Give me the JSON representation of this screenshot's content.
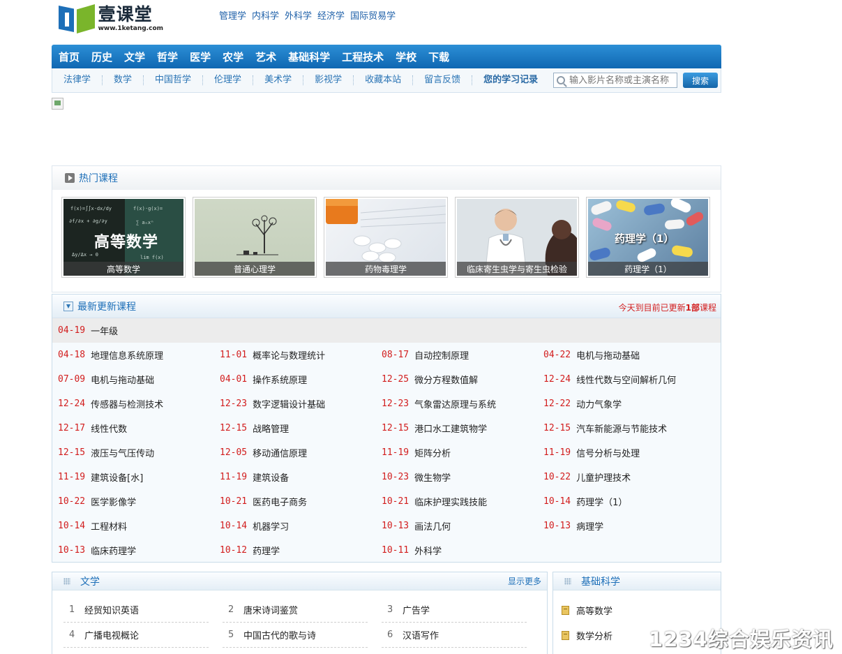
{
  "logo": {
    "name_cn": "壹课堂",
    "url": "www.1ketang.com"
  },
  "top_links": [
    "管理学",
    "内科学",
    "外科学",
    "经济学",
    "国际贸易学"
  ],
  "main_nav": [
    "首页",
    "历史",
    "文学",
    "哲学",
    "医学",
    "农学",
    "艺术",
    "基础科学",
    "工程技术",
    "学校",
    "下载"
  ],
  "sub_nav": [
    "法律学",
    "数学",
    "中国哲学",
    "伦理学",
    "美术学",
    "影视学",
    "收藏本站",
    "留言反馈"
  ],
  "sub_nav_strong": "您的学习记录",
  "search": {
    "placeholder": "输入影片名称或主演名称",
    "button": "搜索"
  },
  "hot": {
    "title": "热门课程",
    "courses": [
      {
        "caption": "高等数学",
        "overlay": "高等数学"
      },
      {
        "caption": "普通心理学"
      },
      {
        "caption": "药物毒理学"
      },
      {
        "caption": "临床寄生虫学与寄生虫检验"
      },
      {
        "caption": "药理学（1）",
        "overlay": "药理学（1）"
      }
    ]
  },
  "latest": {
    "title": "最新更新课程",
    "note_prefix": "今天到目前已更新",
    "note_count": "1部",
    "note_suffix": "课程",
    "first": {
      "date": "04-19",
      "name": "一年级"
    },
    "rows": [
      [
        {
          "date": "04-18",
          "name": "地理信息系统原理"
        },
        {
          "date": "11-01",
          "name": "概率论与数理统计"
        },
        {
          "date": "08-17",
          "name": "自动控制原理"
        },
        {
          "date": "04-22",
          "name": "电机与拖动基础"
        }
      ],
      [
        {
          "date": "07-09",
          "name": "电机与拖动基础"
        },
        {
          "date": "04-01",
          "name": "操作系统原理"
        },
        {
          "date": "12-25",
          "name": "微分方程数值解"
        },
        {
          "date": "12-24",
          "name": "线性代数与空间解析几何"
        }
      ],
      [
        {
          "date": "12-24",
          "name": "传感器与检测技术"
        },
        {
          "date": "12-23",
          "name": "数字逻辑设计基础"
        },
        {
          "date": "12-23",
          "name": "气象雷达原理与系统"
        },
        {
          "date": "12-22",
          "name": "动力气象学"
        }
      ],
      [
        {
          "date": "12-17",
          "name": "线性代数"
        },
        {
          "date": "12-15",
          "name": "战略管理"
        },
        {
          "date": "12-15",
          "name": "港口水工建筑物学"
        },
        {
          "date": "12-15",
          "name": "汽车新能源与节能技术"
        }
      ],
      [
        {
          "date": "12-15",
          "name": "液压与气压传动"
        },
        {
          "date": "12-05",
          "name": "移动通信原理"
        },
        {
          "date": "11-19",
          "name": "矩阵分析"
        },
        {
          "date": "11-19",
          "name": "信号分析与处理"
        }
      ],
      [
        {
          "date": "11-19",
          "name": "建筑设备[水]"
        },
        {
          "date": "11-19",
          "name": "建筑设备"
        },
        {
          "date": "10-23",
          "name": "微生物学"
        },
        {
          "date": "10-22",
          "name": "儿童护理技术"
        }
      ],
      [
        {
          "date": "10-22",
          "name": "医学影像学"
        },
        {
          "date": "10-21",
          "name": "医药电子商务"
        },
        {
          "date": "10-21",
          "name": "临床护理实践技能"
        },
        {
          "date": "10-14",
          "name": "药理学（1）"
        }
      ],
      [
        {
          "date": "10-14",
          "name": "工程材料"
        },
        {
          "date": "10-14",
          "name": "机器学习"
        },
        {
          "date": "10-13",
          "name": "画法几何"
        },
        {
          "date": "10-13",
          "name": "病理学"
        }
      ],
      [
        {
          "date": "10-13",
          "name": "临床药理学"
        },
        {
          "date": "10-12",
          "name": "药理学"
        },
        {
          "date": "10-11",
          "name": "外科学"
        }
      ]
    ]
  },
  "literature": {
    "title": "文学",
    "more": "显示更多",
    "items": [
      {
        "num": "1",
        "name": "经贸知识英语"
      },
      {
        "num": "2",
        "name": "唐宋诗词鉴赏"
      },
      {
        "num": "3",
        "name": "广告学"
      },
      {
        "num": "4",
        "name": "广播电视概论"
      },
      {
        "num": "5",
        "name": "中国古代的歌与诗"
      },
      {
        "num": "6",
        "name": "汉语写作"
      }
    ]
  },
  "science": {
    "title": "基础科学",
    "items": [
      "高等数学",
      "数学分析"
    ]
  },
  "watermark": "1234综合娱乐资讯网"
}
